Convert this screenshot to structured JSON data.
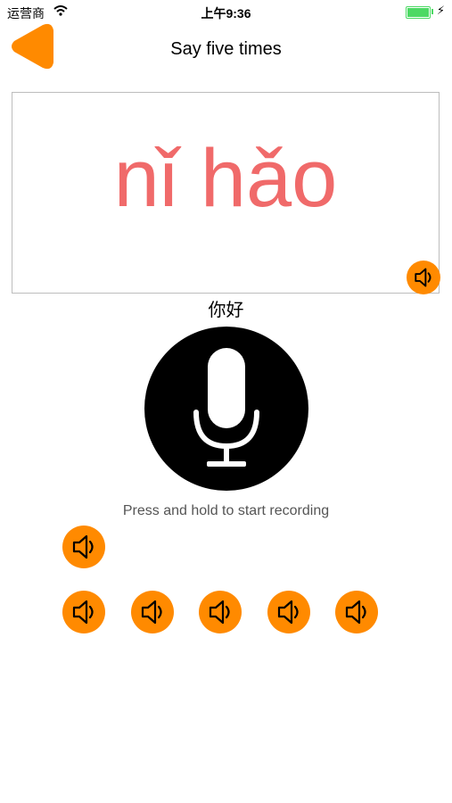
{
  "status_bar": {
    "carrier": "运营商",
    "time": "上午9:36"
  },
  "nav": {
    "title": "Say five times"
  },
  "card": {
    "pinyin": "nǐ hǎo"
  },
  "hanzi": "你好",
  "hint": "Press and hold to start recording",
  "colors": {
    "accent": "#ff8a00",
    "pinyin": "#f06a6a",
    "battery": "#4cd964"
  },
  "icons": {
    "back": "back-arrow-icon",
    "speaker": "speaker-icon",
    "mic": "microphone-icon"
  }
}
